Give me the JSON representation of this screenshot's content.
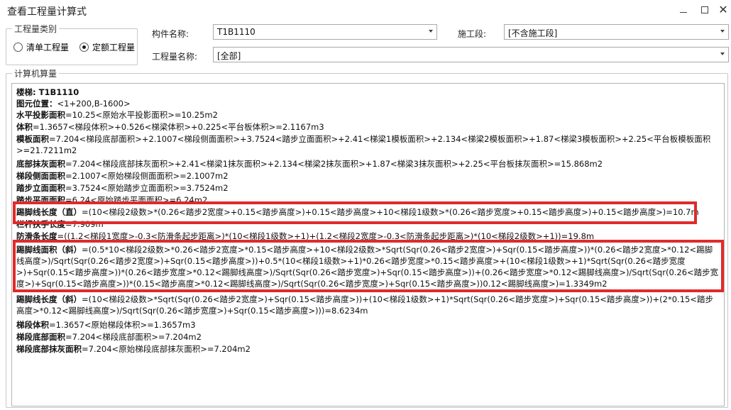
{
  "window": {
    "title": "查看工程量计算式"
  },
  "type_group": {
    "legend": "工程量类别",
    "options": [
      {
        "label": "清单工程量",
        "selected": false
      },
      {
        "label": "定额工程量",
        "selected": true
      }
    ]
  },
  "fields": {
    "component_label": "构件名称:",
    "component_value": "T1B1110",
    "stage_label": "施工段:",
    "stage_value": "[不含施工段]",
    "qty_name_label": "工程量名称:",
    "qty_name_value": "[全部]"
  },
  "calc_group": {
    "legend": "计算机算量"
  },
  "lines": [
    {
      "label": "楼梯: T1B1110",
      "text": ""
    },
    {
      "label": "图元位置：",
      "text": "<1+200,B-1600>"
    },
    {
      "label": "水平投影面积",
      "text": "=10.25<原始水平投影面积>=10.25m2"
    },
    {
      "label": "体积",
      "text": "=1.3657<梯段体积>+0.526<梯梁体积>+0.225<平台板体积>=2.1167m3"
    },
    {
      "label": "模板面积",
      "text": "=7.204<梯段底部面积>+2.1007<梯段侧面面积>+3.7524<踏步立面面积>+2.41<梯梁1模板面积>+2.134<梯梁2模板面积>+1.87<梯梁3模板面积>+2.25<平台板模板面积>=21.7211m2"
    },
    {
      "label": "底部抹灰面积",
      "text": "=7.204<梯段底部抹灰面积>+2.41<梯梁1抹灰面积>+2.134<梯梁2抹灰面积>+1.87<梯梁3抹灰面积>+2.25<平台板抹灰面积>=15.868m2"
    },
    {
      "label": "梯段侧面面积",
      "text": "=2.1007<原始梯段侧面面积>=2.1007m2"
    },
    {
      "label": "踏步立面面积",
      "text": "=3.7524<原始踏步立面面积>=3.7524m2"
    },
    {
      "label": "踏步平面面积",
      "text": "=6.24<原始踏步平面面积>=6.24m2"
    },
    {
      "label": "踢脚线长度（直）",
      "text": "=(10<梯段2级数>*(0.26<踏步2宽度>+0.15<踏步高度>)+0.15<踏步高度>+10<梯段1级数>*(0.26<踏步宽度>+0.15<踏步高度>)+0.15<踏步高度>)=10.7m"
    },
    {
      "label": "栏杆扶手长度",
      "text": "=7.909m"
    },
    {
      "label": "防滑条长度",
      "text": "=((1.2<梯段1宽度>-0.3<防滑条起步距离>)*(10<梯段1级数>+1)+(1.2<梯段2宽度>-0.3<防滑条起步距离>)*(10<梯段2级数>+1))=19.8m"
    },
    {
      "label": "踢脚线面积（斜）",
      "text": "=(0.5*10<梯段2级数>*0.26<踏步2宽度>*0.15<踏步高度>+10<梯段2级数>*Sqrt(Sqr(0.26<踏步2宽度>)+Sqr(0.15<踏步高度>))*(0.26<踏步2宽度>*0.12<踢脚线高度>)/Sqrt(Sqr(0.26<踏步2宽度>)+Sqr(0.15<踏步高度>))+0.5*(10<梯段1级数>+1)*0.26<踏步宽度>*0.15<踏步高度>+(10<梯段1级数>+1)*Sqrt(Sqr(0.26<踏步宽度>)+Sqr(0.15<踏步高度>))*(0.26<踏步宽度>*0.12<踢脚线高度>)/Sqrt(Sqr(0.26<踏步宽度>)+Sqr(0.15<踏步高度>))+(0.26<踏步宽度>*0.12<踢脚线高度>)/Sqrt(Sqr(0.26<踏步宽度>)+Sqr(0.15<踏步高度>))*(0.15<踏步高度>*0.12<踢脚线高度>)/Sqrt(Sqr(0.26<踏步宽度>)+Sqr(0.15<踏步高度>))0.12<踢脚线高度>)=1.3349m2"
    },
    {
      "label": "踢脚线长度（斜）",
      "text": "=(10<梯段2级数>*Sqrt(Sqr(0.26<踏步2宽度>)+Sqr(0.15<踏步高度>))+(10<梯段1级数>+1)*Sqrt(Sqr(0.26<踏步宽度>)+Sqr(0.15<踏步高度>))+(2*0.15<踏步高度>*0.12<踢脚线高度>)/Sqrt(Sqr(0.26<踏步宽度>)+Sqr(0.15<踏步高度>)))=8.6234m"
    },
    {
      "label": "梯段体积",
      "text": "=1.3657<原始梯段体积>=1.3657m3"
    },
    {
      "label": "梯段底部面积",
      "text": "=7.204<梯段底部面积>=7.204m2"
    },
    {
      "label": "梯段底部抹灰面积",
      "text": "=7.204<原始梯段底部抹灰面积>=7.204m2"
    }
  ],
  "colors": {
    "highlight": "#e02a2a",
    "border": "#c8c8c8"
  }
}
